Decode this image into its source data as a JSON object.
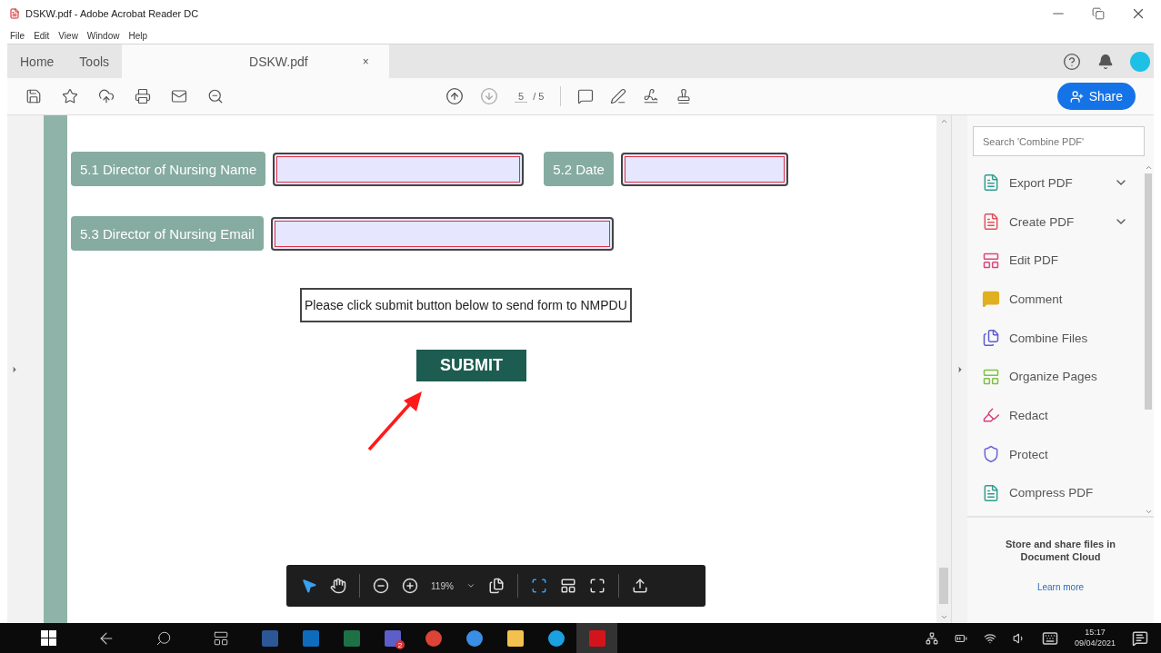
{
  "window": {
    "title": "DSKW.pdf - Adobe Acrobat Reader DC"
  },
  "menu": [
    "File",
    "Edit",
    "View",
    "Window",
    "Help"
  ],
  "tabs": [
    {
      "label": "Home",
      "selected": false
    },
    {
      "label": "Tools",
      "selected": false
    },
    {
      "label": "DSKW.pdf",
      "selected": true,
      "close": "×"
    }
  ],
  "toolbar": {
    "page_current": "5",
    "page_total": "/ 5",
    "share": "Share"
  },
  "form": {
    "rows": [
      [
        {
          "label": "5.1 Director of Nursing Name"
        },
        {
          "label": "5.2 Date"
        }
      ],
      [
        {
          "label": "5.3 Director of Nursing Email"
        }
      ]
    ],
    "note": "Please click submit button below to send form to NMPDU",
    "submit": "SUBMIT"
  },
  "sidebar": {
    "search_placeholder": "Search 'Combine PDF'",
    "tools": [
      {
        "label": "Export PDF",
        "kind": "page",
        "color": "#2f9e8f",
        "expandable": true
      },
      {
        "label": "Create PDF",
        "kind": "page",
        "color": "#e0505a",
        "expandable": true
      },
      {
        "label": "Edit PDF",
        "kind": "layout",
        "color": "#e0457b",
        "expandable": false
      },
      {
        "label": "Comment",
        "kind": "bubble",
        "color": "#e0b020",
        "expandable": false
      },
      {
        "label": "Combine Files",
        "kind": "pages",
        "color": "#5b5bd6",
        "expandable": false
      },
      {
        "label": "Organize Pages",
        "kind": "layout",
        "color": "#7cc242",
        "expandable": false
      },
      {
        "label": "Redact",
        "kind": "pen",
        "color": "#d6407a",
        "expandable": false
      },
      {
        "label": "Protect",
        "kind": "shield",
        "color": "#6b62d8",
        "expandable": false
      },
      {
        "label": "Compress PDF",
        "kind": "page",
        "color": "#2f9e8f",
        "expandable": false
      }
    ],
    "promo": "Store and share files in Document Cloud",
    "link": "Learn more"
  },
  "zoom_bar": {
    "zoom": "119%"
  },
  "taskbar": {
    "apps": [
      {
        "kind": "word",
        "color": "#2b5797",
        "selected": false
      },
      {
        "kind": "outlook",
        "color": "#0f6cbd",
        "selected": false
      },
      {
        "kind": "excel",
        "color": "#1e7145",
        "selected": false
      },
      {
        "kind": "teams",
        "color": "#5b5fc7",
        "selected": false,
        "badge": "2"
      },
      {
        "kind": "chrome",
        "color": "#db4437",
        "selected": false
      },
      {
        "kind": "edge",
        "color": "#3a8ee6",
        "selected": false
      },
      {
        "kind": "folder",
        "color": "#f2c14e",
        "selected": false
      },
      {
        "kind": "ie",
        "color": "#1ba1e2",
        "selected": false
      },
      {
        "kind": "acrobat",
        "color": "#d4141b",
        "selected": true
      }
    ],
    "time": "15:17",
    "date": "09/04/2021"
  }
}
